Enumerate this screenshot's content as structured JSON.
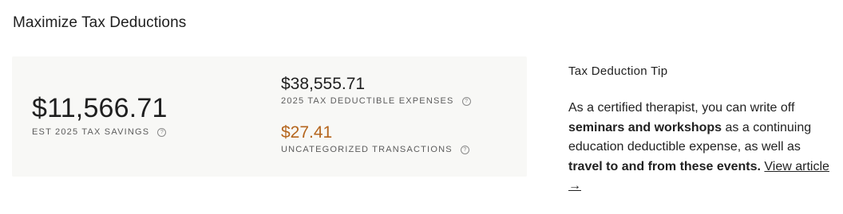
{
  "section": {
    "title": "Maximize Tax Deductions"
  },
  "savings": {
    "value": "$11,566.71",
    "label": "EST 2025 TAX SAVINGS"
  },
  "expenses": {
    "value": "$38,555.71",
    "label": "2025 TAX DEDUCTIBLE EXPENSES"
  },
  "uncategorized": {
    "value": "$27.41",
    "label": "UNCATEGORIZED TRANSACTIONS",
    "color": "#b5651d"
  },
  "info_icon": {
    "glyph": "?",
    "icon": "question-circle-icon"
  },
  "tip": {
    "title": "Tax Deduction Tip",
    "text_1": "As a certified therapist, you can write off ",
    "bold_1": "seminars and workshops",
    "text_2": " as a continuing education deductible expense, as well as ",
    "bold_2": "travel to and from these events.",
    "text_3": " ",
    "link_label": "View article →"
  },
  "colors": {
    "card_background": "#f8f8f6",
    "accent_warning": "#b5651d"
  }
}
